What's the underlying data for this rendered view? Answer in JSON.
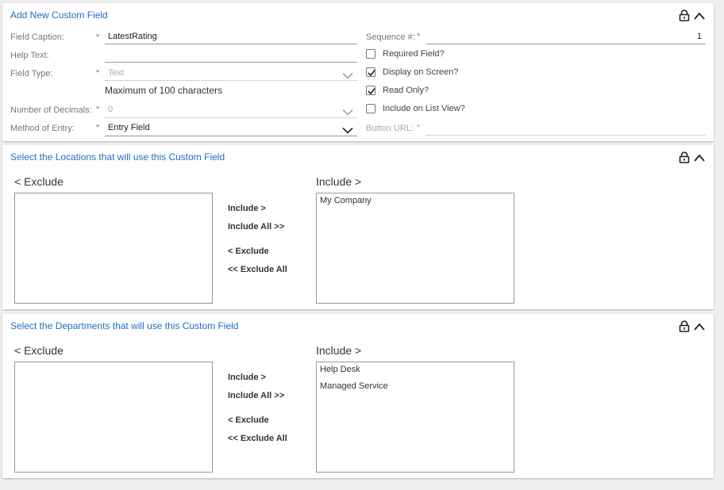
{
  "field_panel": {
    "title": "Add New Custom Field",
    "field_caption": {
      "label": "Field Caption:",
      "required_mark": "*",
      "value": "LatestRating"
    },
    "help_text": {
      "label": "Help Text:",
      "value": ""
    },
    "field_type": {
      "label": "Field Type:",
      "required_mark": "*",
      "value": "Text",
      "hint": "Maximum of 100 characters"
    },
    "number_of_decimals": {
      "label": "Number of Decimals:",
      "required_mark": "*",
      "value": "0"
    },
    "method_of_entry": {
      "label": "Method of Entry:",
      "required_mark": "*",
      "value": "Entry Field"
    },
    "sequence": {
      "label": "Sequence #:",
      "required_mark": "*",
      "value": "1"
    },
    "required_field": {
      "label": "Required Field?",
      "checked": false
    },
    "display_on_screen": {
      "label": "Display on Screen?",
      "checked": true
    },
    "read_only": {
      "label": "Read Only?",
      "checked": true
    },
    "include_on_list_view": {
      "label": "Include on List View?",
      "checked": false
    },
    "button_url": {
      "label": "Button URL:",
      "required_mark": "*",
      "value": ""
    }
  },
  "locations_panel": {
    "title": "Select the Locations that will use this Custom Field",
    "exclude_header": "< Exclude",
    "include_header": "Include >",
    "excluded_items": [],
    "included_items": [
      "My Company"
    ],
    "buttons": {
      "include": "Include >",
      "include_all": "Include All >>",
      "exclude": "< Exclude",
      "exclude_all": "<< Exclude All"
    }
  },
  "departments_panel": {
    "title": "Select the Departments that will use this Custom Field",
    "exclude_header": "< Exclude",
    "include_header": "Include >",
    "excluded_items": [],
    "included_items": [
      "Help Desk",
      "Managed Service"
    ],
    "buttons": {
      "include": "Include >",
      "include_all": "Include All >>",
      "exclude": "< Exclude",
      "exclude_all": "<< Exclude All"
    }
  },
  "colors": {
    "accent": "#1f6fbf",
    "label": "#777777",
    "border": "#999999"
  }
}
